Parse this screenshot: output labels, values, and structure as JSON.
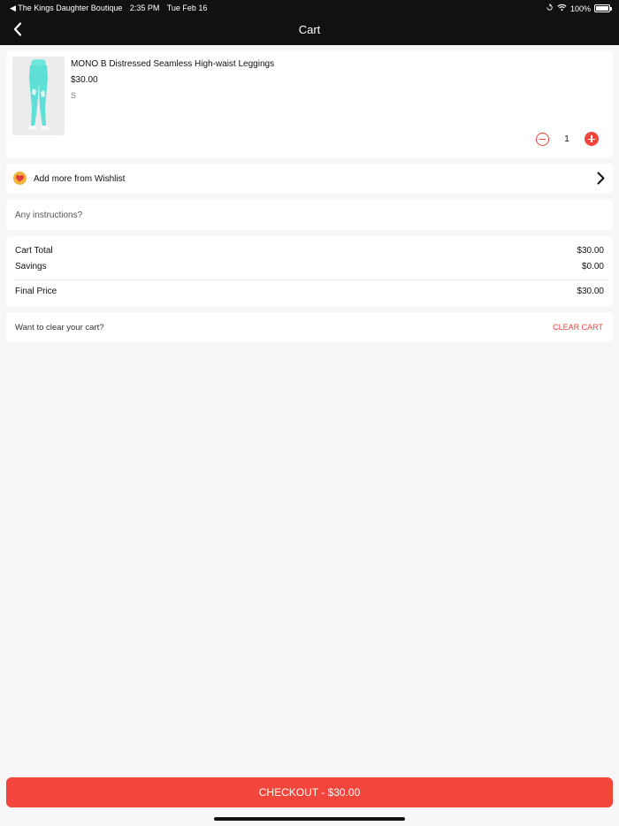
{
  "status_bar": {
    "back_app": "◀ The Kings Daughter Boutique",
    "time": "2:35 PM",
    "date": "Tue Feb 16",
    "battery": "100%"
  },
  "nav": {
    "title": "Cart",
    "back_icon": "chevron-left-icon"
  },
  "product": {
    "name": "MONO B Distressed Seamless High-waist Leggings",
    "price": "$30.00",
    "size": "S",
    "quantity": "1"
  },
  "wishlist": {
    "label": "Add more from Wishlist",
    "icon": "heart-icon"
  },
  "instructions": {
    "placeholder": "Any instructions?",
    "value": ""
  },
  "summary": {
    "cart_total_label": "Cart Total",
    "cart_total_value": "$30.00",
    "savings_label": "Savings",
    "savings_value": "$0.00",
    "final_price_label": "Final Price",
    "final_price_value": "$30.00"
  },
  "clear_cart": {
    "prompt": "Want to clear your cart?",
    "action": "CLEAR CART"
  },
  "checkout": {
    "label": "CHECKOUT - $30.00"
  },
  "colors": {
    "accent": "#f2463c",
    "header_bg": "#111111",
    "page_bg": "#f7f7f7",
    "leggings": "#5ee0d6"
  }
}
